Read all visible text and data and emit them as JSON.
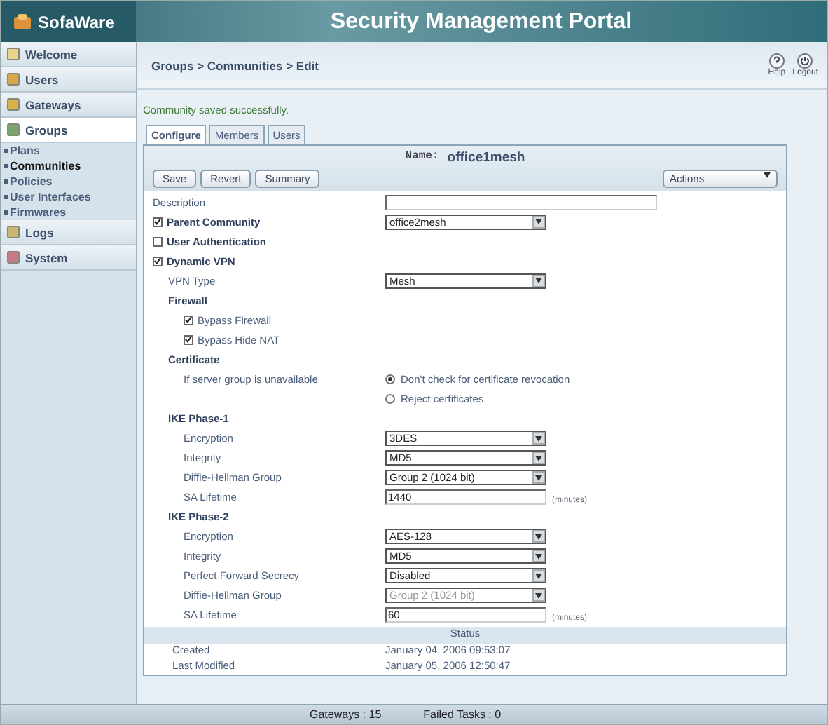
{
  "header": {
    "logo": "SofaWare",
    "title": "Security Management Portal"
  },
  "sidebar": {
    "items": [
      {
        "label": "Welcome",
        "selected": false
      },
      {
        "label": "Users",
        "selected": false
      },
      {
        "label": "Gateways",
        "selected": false
      },
      {
        "label": "Groups",
        "selected": true,
        "children": [
          {
            "label": "Plans",
            "selected": false
          },
          {
            "label": "Communities",
            "selected": true
          },
          {
            "label": "Policies",
            "selected": false
          },
          {
            "label": "User Interfaces",
            "selected": false
          },
          {
            "label": "Firmwares",
            "selected": false
          }
        ]
      },
      {
        "label": "Logs",
        "selected": false
      },
      {
        "label": "System",
        "selected": false
      }
    ]
  },
  "breadcrumb": "Groups > Communities > Edit",
  "top_actions": [
    {
      "label": "Help",
      "kind": "help"
    },
    {
      "label": "Logout",
      "kind": "logout"
    }
  ],
  "message": "Community saved successfully.",
  "tabs": [
    {
      "label": "Configure",
      "selected": true
    },
    {
      "label": "Members",
      "selected": false
    },
    {
      "label": "Users",
      "selected": false
    }
  ],
  "panel": {
    "name_label": "Name:",
    "name": "office1mesh",
    "buttons": [
      "Save",
      "Revert",
      "Summary"
    ],
    "actions": "Actions",
    "rows": [
      {
        "kind": "text",
        "label": "Description"
      },
      {
        "kind": "check",
        "label": "Parent Community",
        "checked": true,
        "value": "office2mesh"
      },
      {
        "kind": "check",
        "label": "User Authentication",
        "checked": false
      },
      {
        "kind": "check",
        "label": "Dynamic VPN",
        "checked": true,
        "children": [
          {
            "kind": "select",
            "label": "VPN Type",
            "value": "Mesh",
            "disabled": false
          },
          {
            "kind": "heading",
            "label": "Firewall",
            "children": [
              {
                "kind": "check",
                "label": "Bypass Firewall",
                "checked": true
              },
              {
                "kind": "check",
                "label": "Bypass Hide NAT",
                "checked": true
              }
            ]
          },
          {
            "kind": "heading",
            "label": "Certificate",
            "children": [
              {
                "kind": "radio",
                "label": "If server group is unavailable",
                "options": [
                  {
                    "label": "Don't check for certificate revocation",
                    "selected": true
                  },
                  {
                    "label": "Reject certificates",
                    "selected": false
                  }
                ]
              }
            ]
          },
          {
            "kind": "heading",
            "label": "IKE Phase-1",
            "children": [
              {
                "kind": "select",
                "label": "Encryption",
                "value": "3DES",
                "disabled": false
              },
              {
                "kind": "select",
                "label": "Integrity",
                "value": "MD5",
                "disabled": false
              },
              {
                "kind": "select",
                "label": "Diffie-Hellman Group",
                "value": "Group 2 (1024 bit)",
                "disabled": false
              },
              {
                "kind": "number",
                "label": "SA Lifetime",
                "value": "1440",
                "unit": "(minutes)"
              }
            ]
          },
          {
            "kind": "heading",
            "label": "IKE Phase-2",
            "children": [
              {
                "kind": "select",
                "label": "Encryption",
                "value": "AES-128",
                "disabled": false
              },
              {
                "kind": "select",
                "label": "Integrity",
                "value": "MD5",
                "disabled": false
              },
              {
                "kind": "select",
                "label": "Perfect Forward Secrecy",
                "value": "Disabled",
                "disabled": false
              },
              {
                "kind": "select",
                "label": "Diffie-Hellman Group",
                "value": "Group 2 (1024 bit)",
                "disabled": true
              },
              {
                "kind": "number",
                "label": "SA Lifetime",
                "value": "60",
                "unit": "(minutes)"
              }
            ]
          }
        ]
      }
    ],
    "status_title": "Status",
    "status": [
      {
        "label": "Created",
        "value": "January 04, 2006 09:53:07"
      },
      {
        "label": "Last Modified",
        "value": "January 05, 2006 12:50:47"
      }
    ]
  },
  "status_bar": [
    "Gateways : 15",
    "Failed Tasks : 0"
  ]
}
